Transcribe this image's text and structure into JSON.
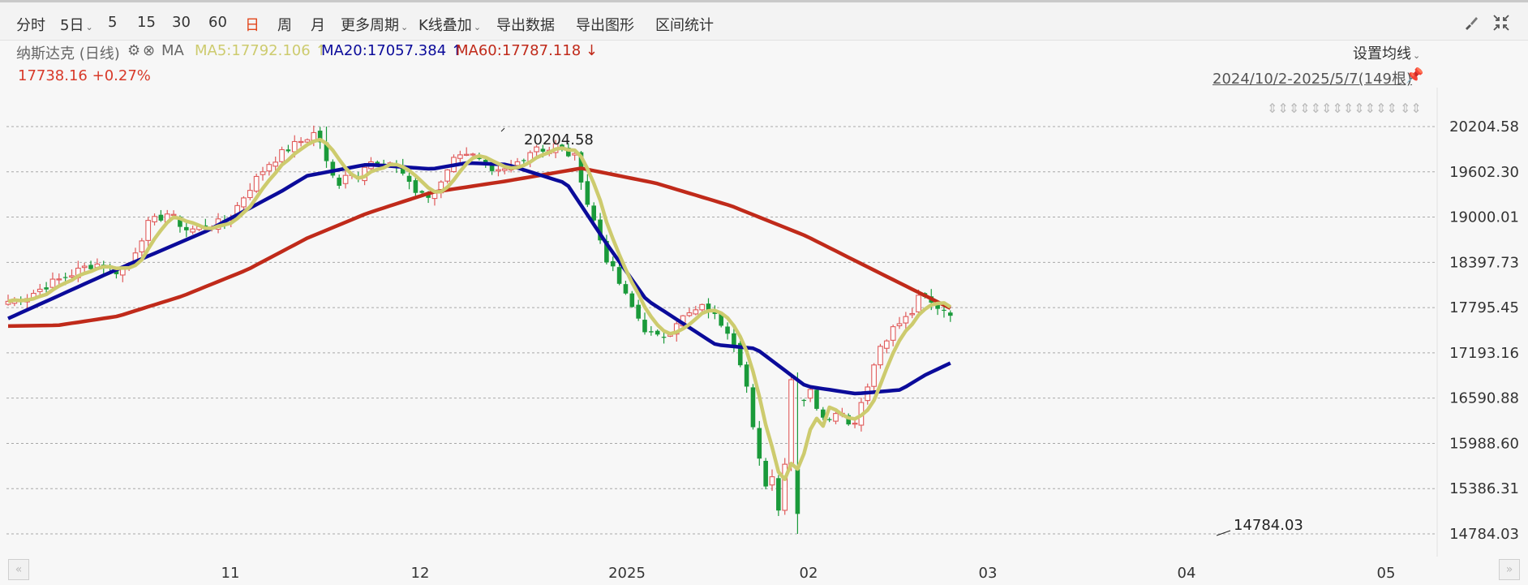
{
  "toolbar": {
    "periods": [
      "分时",
      "5日",
      "5",
      "15",
      "30",
      "60",
      "日",
      "周",
      "月"
    ],
    "active_period": "日",
    "more_periods": "更多周期",
    "kline_overlay": "K线叠加",
    "export_data": "导出数据",
    "export_chart": "导出图形",
    "range_stats": "区间统计",
    "icons": [
      "brush-icon",
      "shrink-icon"
    ]
  },
  "info": {
    "title": "纳斯达克 (日线)",
    "ma_label": "MA",
    "ma5": "MA5:17792.106",
    "ma20": "MA20:17057.384",
    "ma60": "MA60:17787.118",
    "ma5_arrow": "↑",
    "ma20_arrow": "↑",
    "ma60_arrow": "↓",
    "price_change": "17738.16 +0.27%",
    "settings": "设置均线",
    "date_range": "2024/10/2-2025/5/7(149根)",
    "arrows_row": "⇕⇕⇕⇕⇕⇕⇕⇕⇕⇕⇕⇕",
    "arrows_row2": "⇕⇕"
  },
  "colors": {
    "up": "#e05a5a",
    "down": "#1a9a3a",
    "ma5": "#cdcb6e",
    "ma20": "#0b0b9a",
    "ma60": "#c02a1a",
    "accent": "#e2461b"
  },
  "chart_data": {
    "type": "candlestick",
    "title": "纳斯达克 (日线)",
    "y_ticks": [
      "20204.58",
      "19602.30",
      "19000.01",
      "18397.73",
      "17795.45",
      "17193.16",
      "16590.88",
      "15988.60",
      "15386.31",
      "14784.03"
    ],
    "ylim": [
      14784.03,
      20204.58
    ],
    "x_ticks": [
      {
        "label": "11",
        "index": 21
      },
      {
        "label": "12",
        "index": 42
      },
      {
        "label": "2025",
        "index": 63
      },
      {
        "label": "02",
        "index": 83
      },
      {
        "label": "03",
        "index": 102
      },
      {
        "label": "04",
        "index": 123
      },
      {
        "label": "05",
        "index": 143
      }
    ],
    "annotations": [
      {
        "text": "20204.58",
        "index": 50,
        "value": 20204.58,
        "kind": "high"
      },
      {
        "text": "14784.03",
        "index": 127,
        "value": 14784.03,
        "kind": "low"
      }
    ],
    "candles": [],
    "ma5": [],
    "ma20": [],
    "ma60": [],
    "grid": true,
    "legend": "top-left"
  }
}
